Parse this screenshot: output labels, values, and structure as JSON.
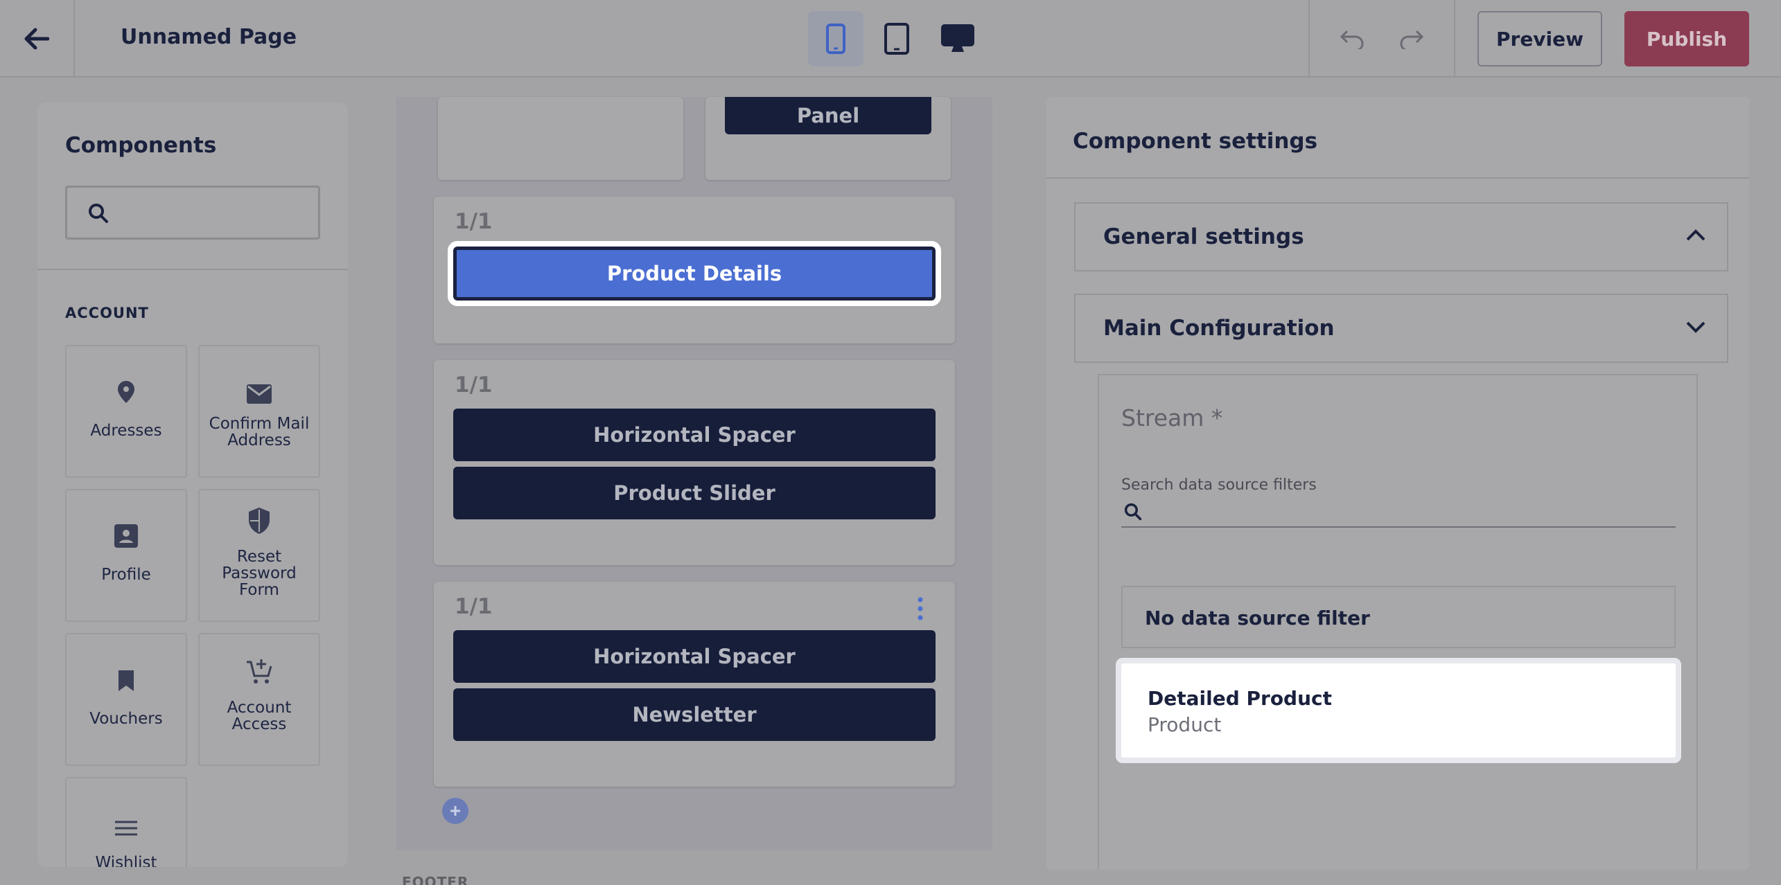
{
  "header": {
    "page_title": "Unnamed Page",
    "preview_label": "Preview",
    "publish_label": "Publish",
    "colors": {
      "publish": "#8c3c52",
      "active_device": "#4a6ed2"
    }
  },
  "components": {
    "title": "Components",
    "search_placeholder": "",
    "group_label": "ACCOUNT",
    "items": [
      {
        "label": "Adresses",
        "icon": "location-pin-icon"
      },
      {
        "label": "Confirm Mail Address",
        "icon": "mail-icon"
      },
      {
        "label": "Profile",
        "icon": "profile-card-icon"
      },
      {
        "label": "Reset Password Form",
        "icon": "shield-icon"
      },
      {
        "label": "Vouchers",
        "icon": "bookmark-icon"
      },
      {
        "label": "Account Access",
        "icon": "cart-add-icon"
      },
      {
        "label": "Wishlist",
        "icon": "list-icon"
      }
    ]
  },
  "canvas": {
    "top_panel_label": "Panel",
    "sections": [
      {
        "col": "1/1",
        "blocks": [
          "Product Details"
        ]
      },
      {
        "col": "1/1",
        "blocks": [
          "Horizontal Spacer",
          "Product Slider"
        ]
      },
      {
        "col": "1/1",
        "blocks": [
          "Horizontal Spacer",
          "Newsletter"
        ]
      }
    ],
    "footer_label": "FOOTER"
  },
  "settings": {
    "title": "Component settings",
    "general_label": "General settings",
    "main_label": "Main Configuration",
    "stream_label": "Stream *",
    "search_label": "Search data source filters",
    "no_filter_label": "No data source filter",
    "detailed_title": "Detailed Product",
    "detailed_sub": "Product"
  }
}
